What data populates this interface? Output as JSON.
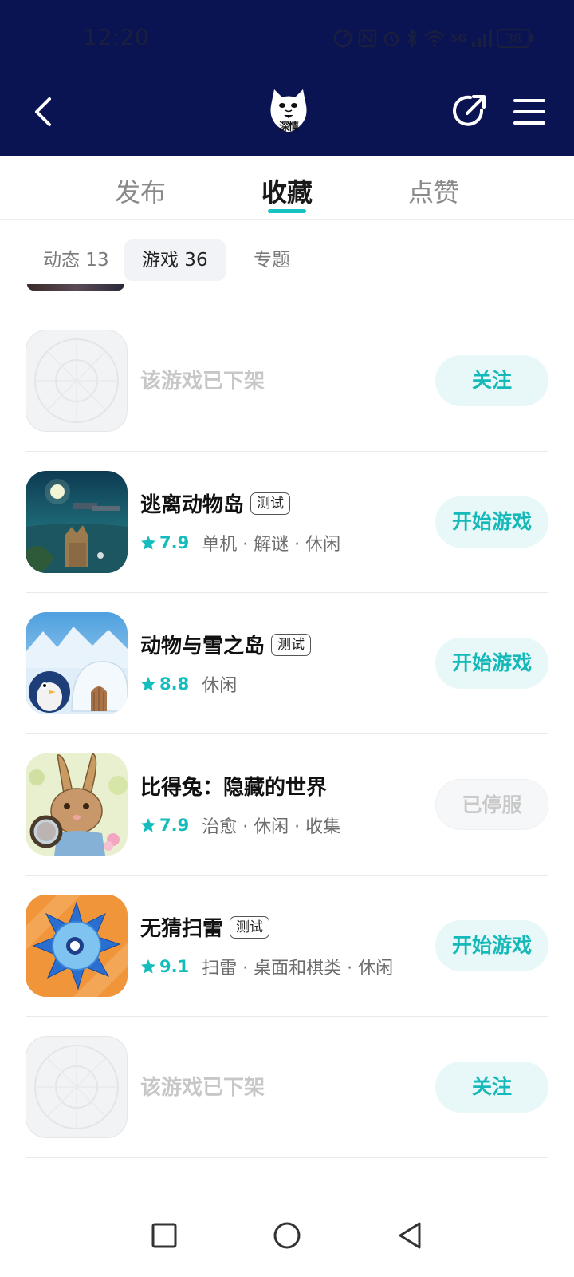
{
  "status_bar": {
    "time": "12:20",
    "network": "5G",
    "battery": "38"
  },
  "header": {
    "avatar_text": "深情"
  },
  "main_tabs": [
    {
      "label": "发布",
      "active": false
    },
    {
      "label": "收藏",
      "active": true
    },
    {
      "label": "点赞",
      "active": false
    }
  ],
  "sub_tabs": [
    {
      "label": "动态 13",
      "active": false
    },
    {
      "label": "游戏 36",
      "active": true
    },
    {
      "label": "专题",
      "active": false
    }
  ],
  "accent_color": "#19c2c2",
  "games": [
    {
      "removed": true,
      "removed_text": "该游戏已下架",
      "action": "关注"
    },
    {
      "title": "逃离动物岛",
      "badge": "测试",
      "rating": "7.9",
      "tags": "单机 · 解谜 · 休闲",
      "action": "开始游戏",
      "icon": "night-island-cat-icon"
    },
    {
      "title": "动物与雪之岛",
      "badge": "测试",
      "rating": "8.8",
      "tags": "休闲",
      "action": "开始游戏",
      "icon": "snow-igloo-penguin-icon"
    },
    {
      "title": "比得兔：隐藏的世界",
      "rating": "7.9",
      "tags": "治愈 · 休闲 · 收集",
      "action": "已停服",
      "action_disabled": true,
      "icon": "rabbit-magnifier-icon"
    },
    {
      "title": "无猜扫雷",
      "badge": "测试",
      "rating": "9.1",
      "tags": "扫雷 · 桌面和棋类 · 休闲",
      "action": "开始游戏",
      "icon": "mine-icon"
    },
    {
      "removed": true,
      "removed_text": "该游戏已下架",
      "action": "关注"
    }
  ]
}
